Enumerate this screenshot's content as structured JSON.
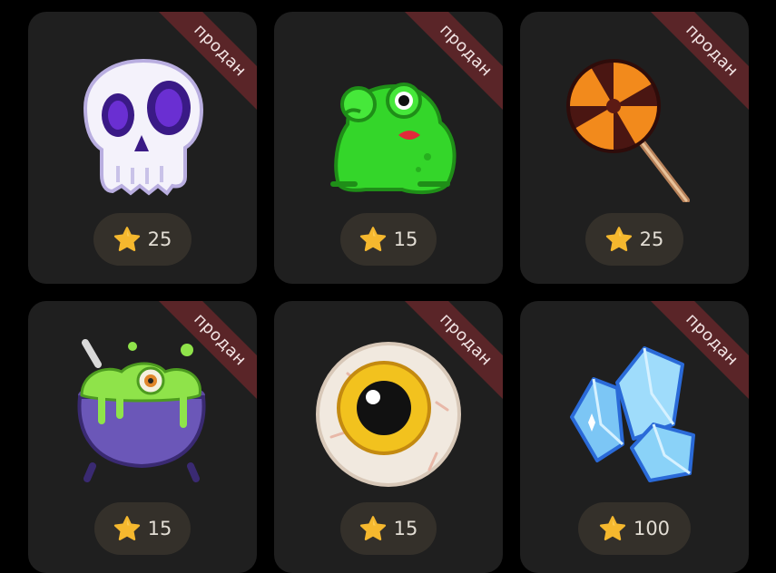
{
  "items": [
    {
      "name": "skull",
      "icon": "skull-icon",
      "badge": "продан",
      "price": "25"
    },
    {
      "name": "frog",
      "icon": "frog-icon",
      "badge": "продан",
      "price": "15"
    },
    {
      "name": "lollipop",
      "icon": "lollipop-icon",
      "badge": "продан",
      "price": "25"
    },
    {
      "name": "cauldron",
      "icon": "cauldron-icon",
      "badge": "продан",
      "price": "15"
    },
    {
      "name": "eyeball",
      "icon": "eyeball-icon",
      "badge": "продан",
      "price": "15"
    },
    {
      "name": "crystals",
      "icon": "crystals-icon",
      "badge": "продан",
      "price": "100"
    }
  ],
  "colors": {
    "background": "#000000",
    "card": "#1f1f1f",
    "badge": "#5a2528",
    "price_pill": "#34302a",
    "star": "#f5b82e"
  }
}
